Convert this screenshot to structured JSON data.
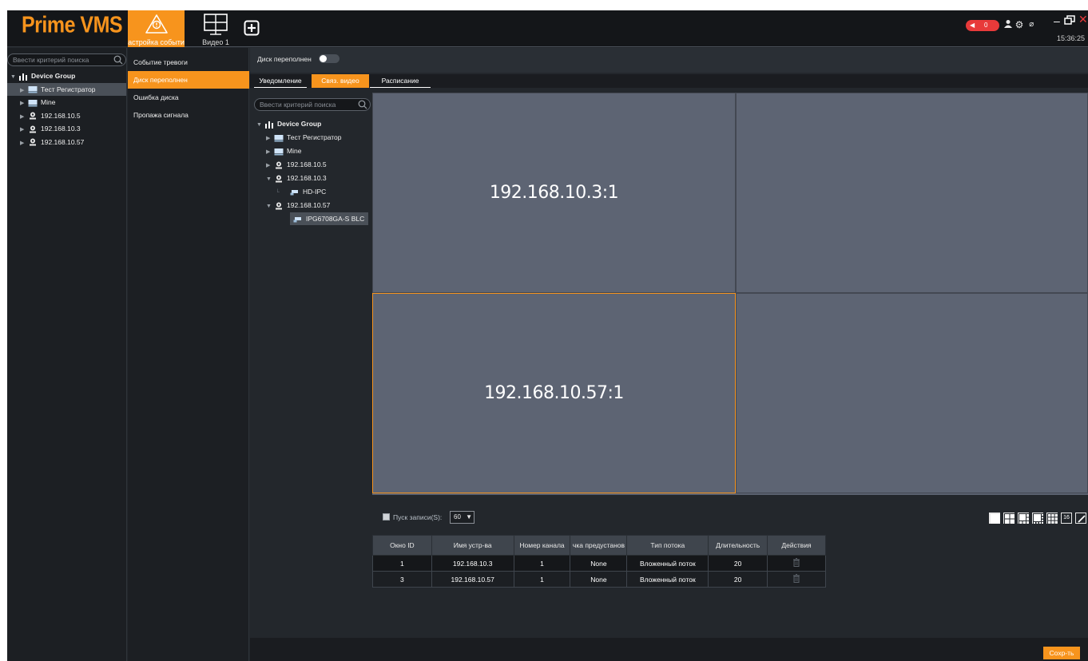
{
  "header": {
    "logo": "Prime VMS",
    "tabs": [
      {
        "label": "астройка событи",
        "icon": "alarm-warning-icon",
        "active": true
      },
      {
        "label": "Видео 1",
        "icon": "video-layout-icon",
        "active": false
      }
    ],
    "add_tab_icon": "plus-box-icon",
    "alarm_count": "0",
    "clock": "15:36:25",
    "icons": [
      "user-icon",
      "gear-icon",
      "speed-icon"
    ]
  },
  "left_panel": {
    "search_placeholder": "Ввести критерий поиска",
    "tree": [
      {
        "label": "Device Group",
        "level": 0,
        "expanded": true,
        "icon": "group-icon"
      },
      {
        "label": "Тест Регистратор",
        "level": 1,
        "icon": "nvr-icon",
        "selected": true
      },
      {
        "label": "Mine",
        "level": 1,
        "icon": "nvr-icon"
      },
      {
        "label": "192.168.10.5",
        "level": 1,
        "icon": "camera-device-icon"
      },
      {
        "label": "192.168.10.3",
        "level": 1,
        "icon": "camera-device-icon"
      },
      {
        "label": "192.168.10.57",
        "level": 1,
        "icon": "camera-device-icon"
      }
    ]
  },
  "event_list": {
    "items": [
      {
        "label": "Событие тревоги",
        "active": false
      },
      {
        "label": "Диск переполнен",
        "active": true
      },
      {
        "label": "Ошибка диска",
        "active": false
      },
      {
        "label": "Пропажа сигнала",
        "active": false
      }
    ]
  },
  "main": {
    "disk_full_label": "Диск переполнен",
    "disk_full_enabled": false,
    "subtabs": [
      {
        "label": "Уведомление",
        "active": false
      },
      {
        "label": "Связ. видео",
        "active": true
      },
      {
        "label": "Расписание",
        "active": false
      }
    ],
    "tree_search_placeholder": "Ввести критерий поиска",
    "tree": [
      {
        "label": "Device Group",
        "level": 0,
        "expanded": true,
        "icon": "group-icon"
      },
      {
        "label": "Тест Регистратор",
        "level": 1,
        "icon": "nvr-icon"
      },
      {
        "label": "Mine",
        "level": 1,
        "icon": "nvr-icon"
      },
      {
        "label": "192.168.10.5",
        "level": 1,
        "icon": "camera-device-icon"
      },
      {
        "label": "192.168.10.3",
        "level": 1,
        "expanded": true,
        "icon": "camera-device-icon"
      },
      {
        "label": "HD-IPC",
        "level": 2,
        "icon": "ipc-camera-icon"
      },
      {
        "label": "192.168.10.57",
        "level": 1,
        "expanded": true,
        "icon": "camera-device-icon"
      },
      {
        "label": "IPG6708GA-S BLC",
        "level": 2,
        "icon": "ipc-camera-icon",
        "selected": true
      }
    ],
    "video_cells": [
      {
        "label": "192.168.10.3:1"
      },
      {
        "label": ""
      },
      {
        "label": "192.168.10.57:1",
        "selected": true
      },
      {
        "label": ""
      }
    ],
    "record_label": "Пуск записи(S):",
    "record_seconds": "60",
    "layout_buttons": [
      "layout-1-icon",
      "layout-4-icon",
      "layout-6-icon",
      "layout-8-icon",
      "layout-9-icon",
      "layout-16-icon",
      "layout-custom-icon"
    ],
    "layout_16_label": "16",
    "table": {
      "headers": [
        "Окно ID",
        "Имя устр-ва",
        "Номер канала",
        "чка предустанов",
        "Тип потока",
        "Длительность",
        "Действия"
      ],
      "rows": [
        [
          "1",
          "192.168.10.3",
          "1",
          "None",
          "Вложенный поток",
          "20"
        ],
        [
          "3",
          "192.168.10.57",
          "1",
          "None",
          "Вложенный поток",
          "20"
        ]
      ]
    },
    "save_label": "Сохр-ть"
  }
}
